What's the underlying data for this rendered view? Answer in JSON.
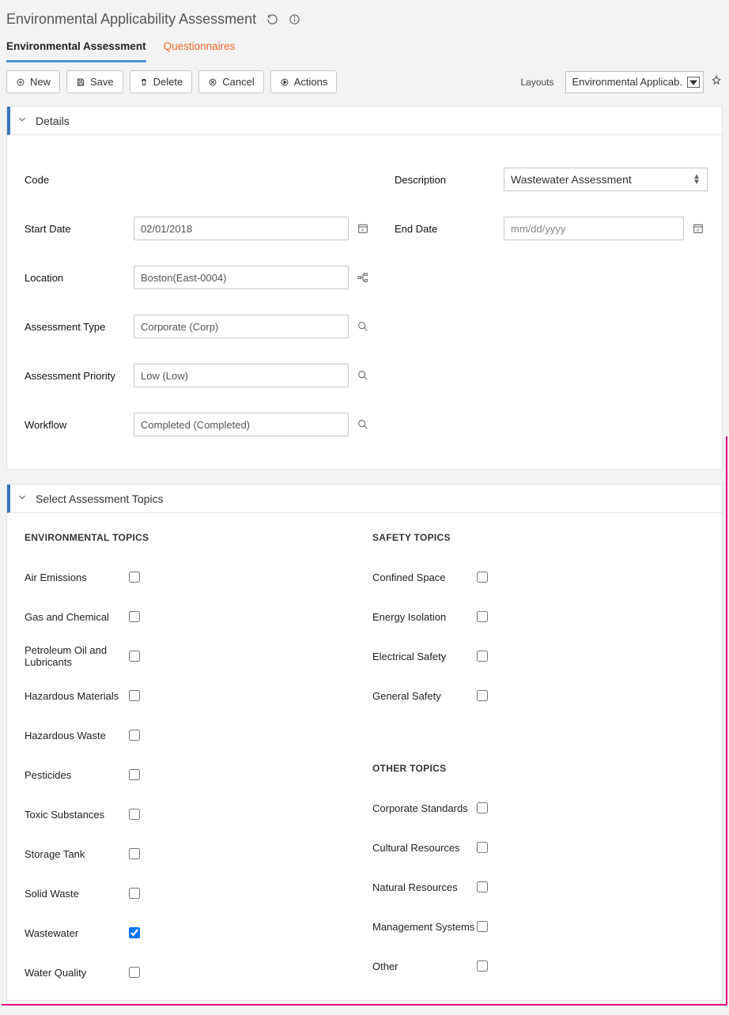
{
  "title": "Environmental Applicability Assessment",
  "tabs": {
    "active": "Environmental Assessment",
    "other": "Questionnaires"
  },
  "toolbar": {
    "new": "New",
    "save": "Save",
    "delete": "Delete",
    "cancel": "Cancel",
    "actions": "Actions",
    "layouts_label": "Layouts",
    "layout_value": "Environmental Applicab."
  },
  "section_details": "Details",
  "fields": {
    "code_label": "Code",
    "code_value": "",
    "description_label": "Description",
    "description_value": "Wastewater Assessment",
    "start_date_label": "Start Date",
    "start_date_value": "02/01/2018",
    "end_date_label": "End Date",
    "end_date_placeholder": "mm/dd/yyyy",
    "location_label": "Location",
    "location_value": "Boston(East-0004)",
    "assessment_type_label": "Assessment Type",
    "assessment_type_value": "Corporate (Corp)",
    "assessment_priority_label": "Assessment Priority",
    "assessment_priority_value": "Low (Low)",
    "workflow_label": "Workflow",
    "workflow_value": "Completed (Completed)"
  },
  "section_topics": "Select Assessment Topics",
  "topic_headings": {
    "env": "ENVIRONMENTAL TOPICS",
    "safety": "SAFETY TOPICS",
    "other": "OTHER TOPICS"
  },
  "env_topics": [
    {
      "label": "Air Emissions",
      "checked": false
    },
    {
      "label": "Gas and Chemical",
      "checked": false
    },
    {
      "label": "Petroleum Oil and Lubricants",
      "checked": false
    },
    {
      "label": "Hazardous Materials",
      "checked": false
    },
    {
      "label": "Hazardous Waste",
      "checked": false
    },
    {
      "label": "Pesticides",
      "checked": false
    },
    {
      "label": "Toxic Substances",
      "checked": false
    },
    {
      "label": "Storage Tank",
      "checked": false
    },
    {
      "label": "Solid Waste",
      "checked": false
    },
    {
      "label": "Wastewater",
      "checked": true
    },
    {
      "label": "Water Quality",
      "checked": false
    }
  ],
  "safety_topics": [
    {
      "label": "Confined Space",
      "checked": false
    },
    {
      "label": "Energy Isolation",
      "checked": false
    },
    {
      "label": "Electrical Safety",
      "checked": false
    },
    {
      "label": "General Safety",
      "checked": false
    }
  ],
  "other_topics": [
    {
      "label": "Corporate Standards",
      "checked": false
    },
    {
      "label": "Cultural Resources",
      "checked": false
    },
    {
      "label": "Natural Resources",
      "checked": false
    },
    {
      "label": "Management Systems",
      "checked": false
    },
    {
      "label": "Other",
      "checked": false
    }
  ]
}
